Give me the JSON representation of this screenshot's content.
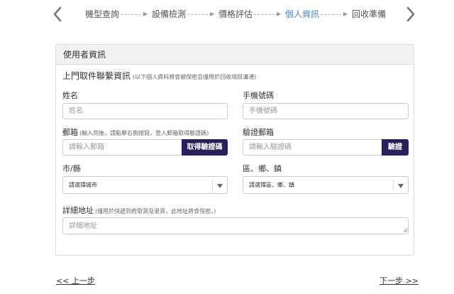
{
  "steps": [
    {
      "label": "機型查詢",
      "active": false
    },
    {
      "label": "設備檢測",
      "active": false
    },
    {
      "label": "價格評估",
      "active": false
    },
    {
      "label": "個人資訊",
      "active": true
    },
    {
      "label": "回收準備",
      "active": false
    }
  ],
  "colors": {
    "active_step": "#4f86c6",
    "button_bg": "#2a1e5c",
    "panel_header_bg": "#f2f2f2"
  },
  "panel": {
    "header": "使用者資訊",
    "section_title": "上門取件聯繫資訊",
    "section_note": "(以下個人資料將會被保密且僅用於回收項目溝通)"
  },
  "form": {
    "name": {
      "label": "姓名",
      "placeholder": "姓名"
    },
    "phone": {
      "label": "手機號碼",
      "placeholder": "手機號碼"
    },
    "email": {
      "label": "郵箱",
      "note": "(輸入完後，請點擊右側按鈕，登入郵箱取得驗證碼)",
      "placeholder": "請輸入郵箱",
      "button": "取得驗證碼"
    },
    "verify": {
      "label": "驗證郵箱",
      "placeholder": "請輸入驗證碼",
      "button": "驗證"
    },
    "city": {
      "label": "市/縣",
      "selected": "請選擇城市"
    },
    "district": {
      "label": "區、鄉、鎮",
      "selected": "請選擇區、鄉、鎮"
    },
    "address": {
      "label": "詳細地址",
      "note": "(僅用於快遞到府取貨及退貨，此地址將會保密。)",
      "placeholder": "詳細地址"
    }
  },
  "footer": {
    "prev": "<< 上一步",
    "next": "下一步 >>"
  }
}
